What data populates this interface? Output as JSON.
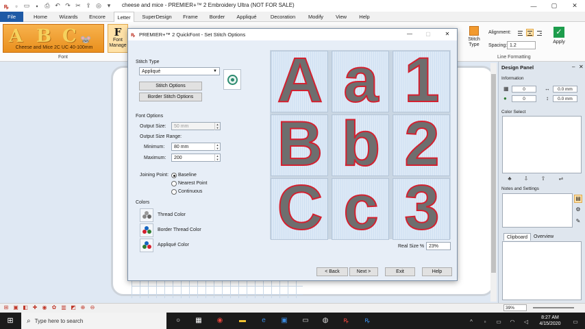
{
  "window": {
    "title": "cheese and mice - PREMIER+™ 2 Embroidery Ultra (NOT FOR SALE)"
  },
  "menu": [
    "File",
    "Home",
    "Wizards",
    "Encore",
    "Letter",
    "SuperDesign",
    "Frame",
    "Border",
    "Appliqué",
    "Decoration",
    "Modify",
    "View",
    "Help"
  ],
  "active_menu": "Letter",
  "ribbon": {
    "font_gallery": {
      "preview_letters": [
        "A",
        "B",
        "C"
      ],
      "label": "Cheese and Mice 2C UC 40-100mm"
    },
    "font_group_label": "Font",
    "font_manager_label": "Font Manage",
    "stitch_type_label": "Stitch Type",
    "alignment_label": "Alignment:",
    "spacing_label": "Spacing:",
    "spacing_value": "1.2",
    "line_formatting_label": "Line Formatting",
    "apply_label": "Apply"
  },
  "design_panel": {
    "title": "Design Panel",
    "information_label": "Information",
    "field1": "0",
    "field2": "0.0 mm",
    "field3": "0",
    "field4": "0.0 mm",
    "color_select_label": "Color Select",
    "notes_label": "Notes and Settings",
    "tabs": [
      "Clipboard",
      "Overview"
    ]
  },
  "statusbar": {
    "zoom": "39%"
  },
  "taskbar": {
    "search_placeholder": "Type here to search",
    "time": "8:27 AM",
    "date": "4/15/2020"
  },
  "dialog": {
    "title": "PREMIER+™ 2 QuickFont - Set Stitch Options",
    "stitch_type_label": "Stitch Type",
    "stitch_type_value": "Appliqué",
    "stitch_options_btn": "Stitch Options",
    "border_stitch_options_btn": "Border Stitch Options",
    "font_options_label": "Font Options",
    "output_size_label": "Output Size:",
    "output_size_value": "50 mm",
    "output_size_range_label": "Output Size Range:",
    "minimum_label": "Minimum:",
    "minimum_value": "80 mm",
    "maximum_label": "Maximum:",
    "maximum_value": "200",
    "joining_point_label": "Joining Point:",
    "joining_options": [
      "Baseline",
      "Nearest Point",
      "Continuous"
    ],
    "joining_selected": "Baseline",
    "colors_label": "Colors",
    "color_buttons": [
      "Thread Color",
      "Border Thread Color",
      "Appliqué Color"
    ],
    "preview_letters": [
      "A",
      "a",
      "1",
      "B",
      "b",
      "2",
      "C",
      "c",
      "3"
    ],
    "real_size_label": "Real Size %",
    "real_size_value": "23%",
    "buttons": {
      "back": "< Back",
      "next": "Next >",
      "exit": "Exit",
      "help": "Help"
    }
  },
  "colors": {
    "file_menu_bg": "#1e5aa6",
    "letter_fill": "#6e6e6e",
    "letter_outline": "#d4202f",
    "apply_green": "#1d9d4c"
  }
}
